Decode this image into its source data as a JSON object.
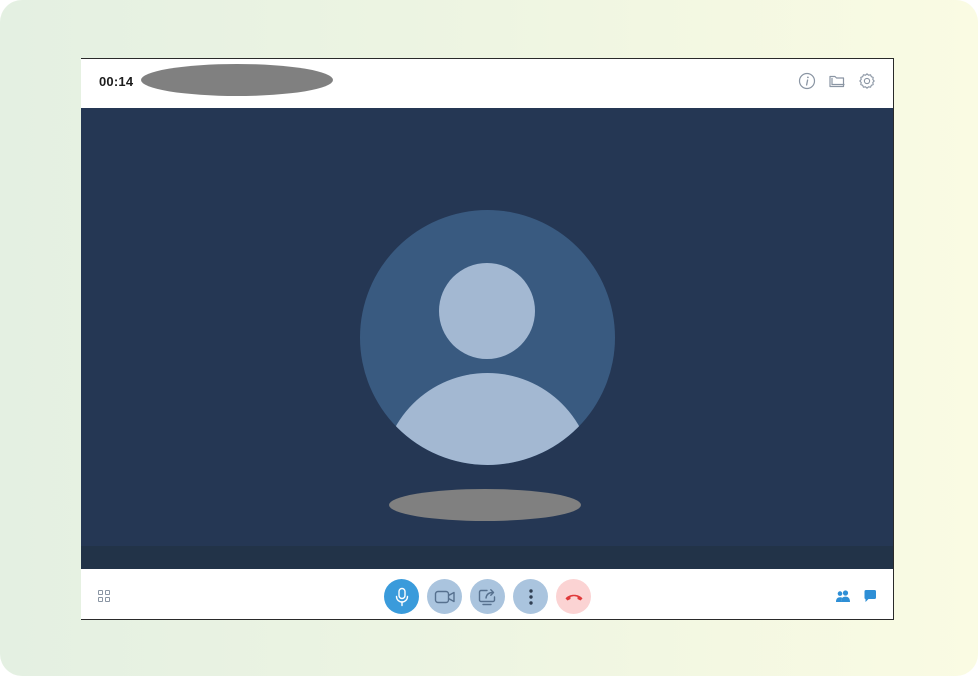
{
  "call": {
    "timer": "00:14"
  },
  "top_bar": {
    "icons": [
      "info-icon",
      "folder-icon",
      "settings-icon"
    ]
  },
  "video": {
    "avatar": "default-user-avatar"
  },
  "bottom_bar": {
    "left_icon": "grid-layout-icon",
    "controls": [
      "microphone-icon",
      "camera-icon",
      "share-screen-icon",
      "more-options-icon",
      "end-call-icon"
    ],
    "right_icons": [
      "participants-icon",
      "chat-icon"
    ]
  },
  "colors": {
    "video_background": "#253754",
    "avatar_circle": "#395a80",
    "avatar_figure": "#a3b8d2",
    "mic_active": "#3a9bdb",
    "control_inactive": "#aac4de",
    "end_call_bg": "#fbd3d3",
    "end_call_icon": "#e0393a",
    "accent_blue": "#2e8fd6"
  }
}
